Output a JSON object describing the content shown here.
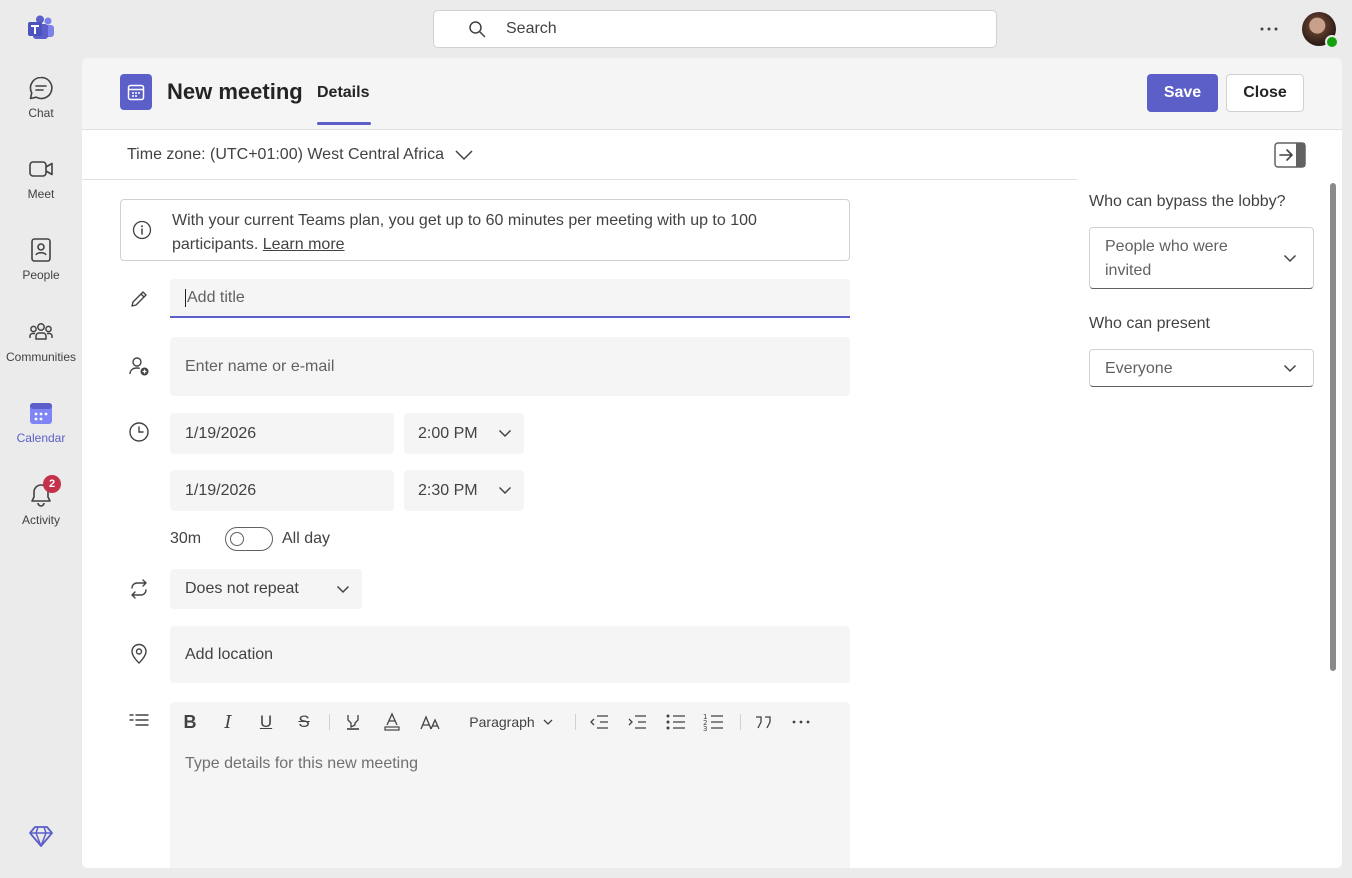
{
  "rail": {
    "items": [
      {
        "label": "Chat",
        "icon": "chat-icon"
      },
      {
        "label": "Meet",
        "icon": "video-icon"
      },
      {
        "label": "People",
        "icon": "people-icon"
      },
      {
        "label": "Communities",
        "icon": "communities-icon"
      },
      {
        "label": "Calendar",
        "icon": "calendar-icon",
        "active": true
      },
      {
        "label": "Activity",
        "icon": "bell-icon",
        "badge": "2"
      }
    ]
  },
  "search": {
    "placeholder": "Search"
  },
  "header": {
    "title": "New meeting",
    "tab": "Details",
    "save_label": "Save",
    "close_label": "Close"
  },
  "timezone": {
    "label": "Time zone: (UTC+01:00) West Central Africa"
  },
  "info": {
    "text": "With your current Teams plan, you get up to 60 minutes per meeting with up to 100 participants.",
    "link": "Learn more"
  },
  "form": {
    "title_placeholder": "Add title",
    "attendees_placeholder": "Enter name or e-mail",
    "start_date": "1/19/2026",
    "start_time": "2:00 PM",
    "end_date": "1/19/2026",
    "end_time": "2:30 PM",
    "duration": "30m",
    "all_day_label": "All day",
    "repeat": "Does not repeat",
    "location_placeholder": "Add location",
    "details_placeholder": "Type details for this new meeting",
    "paragraph_label": "Paragraph"
  },
  "options": {
    "lobby_label": "Who can bypass the lobby?",
    "lobby_value": "People who were invited",
    "present_label": "Who can present",
    "present_value": "Everyone"
  },
  "colors": {
    "accent": "#5b5fc7",
    "badge": "#c4314b",
    "presence": "#13a10e"
  }
}
